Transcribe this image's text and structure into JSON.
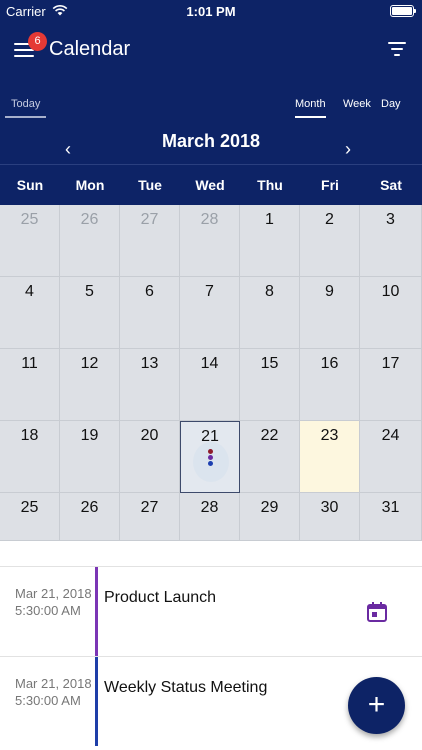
{
  "status_bar": {
    "carrier": "Carrier",
    "time": "1:01 PM"
  },
  "header": {
    "title": "Calendar",
    "notification_count": "6",
    "today_label": "Today",
    "views": [
      "Month",
      "Week",
      "Day"
    ],
    "active_view": "Month",
    "month_title": "March 2018",
    "prev_arrow": "‹",
    "next_arrow": "›"
  },
  "weekdays": [
    "Sun",
    "Mon",
    "Tue",
    "Wed",
    "Thu",
    "Fri",
    "Sat"
  ],
  "calendar": {
    "weeks": [
      [
        "25",
        "26",
        "27",
        "28",
        "1",
        "2",
        "3"
      ],
      [
        "4",
        "5",
        "6",
        "7",
        "8",
        "9",
        "10"
      ],
      [
        "11",
        "12",
        "13",
        "14",
        "15",
        "16",
        "17"
      ],
      [
        "18",
        "19",
        "20",
        "21",
        "22",
        "23",
        "24"
      ],
      [
        "25",
        "26",
        "27",
        "28",
        "29",
        "30",
        "31"
      ]
    ],
    "muted_first_week_days": [
      "25",
      "26",
      "27",
      "28"
    ],
    "selected_day": "21",
    "today_day": "23",
    "event_dot_colors": [
      "#8e1c2b",
      "#6a2aa1",
      "#1c3fb0"
    ]
  },
  "events": [
    {
      "date": "Mar 21, 2018",
      "time": "5:30:00 AM",
      "title": "Product Launch",
      "bar_color": "#7b35b5",
      "icon": "calendar-icon"
    },
    {
      "date": "Mar 21, 2018",
      "time": "5:30:00 AM",
      "title": "Weekly Status Meeting",
      "bar_color": "#1e3ea8"
    }
  ],
  "fab": {
    "label": "+"
  },
  "colors": {
    "header_bg": "#0d2366",
    "grid_bg": "#dde0e5",
    "today_bg": "#fdf7df",
    "badge": "#e53935",
    "calendar_icon": "#6a2aa1"
  }
}
